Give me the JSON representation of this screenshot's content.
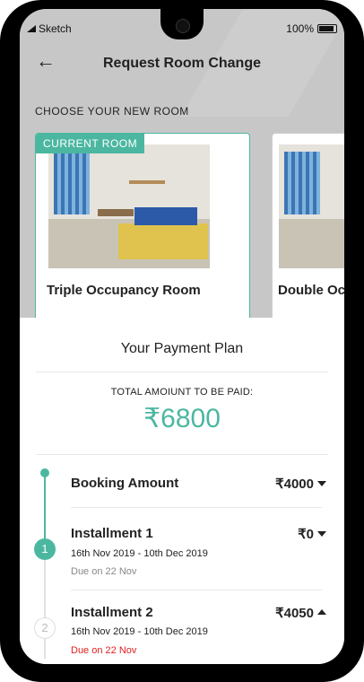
{
  "status_bar": {
    "carrier": "Sketch",
    "battery": "100%"
  },
  "header": {
    "title": "Request Room Change"
  },
  "section_label": "CHOOSE YOUR NEW ROOM",
  "rooms": [
    {
      "tag": "CURRENT ROOM",
      "name": "Triple Occupancy Room"
    },
    {
      "name": "Double Oc"
    }
  ],
  "payment_plan": {
    "title": "Your Payment Plan",
    "total_label": "TOTAL AMOIUNT TO BE PAID:",
    "total_amount": "₹6800",
    "items": [
      {
        "name": "Booking Amount",
        "amount": "₹4000"
      },
      {
        "step": "1",
        "name": "Installment 1",
        "amount": "₹0",
        "dates": "16th Nov 2019 - 10th Dec 2019",
        "due": "Due on 22 Nov"
      },
      {
        "step": "2",
        "name": "Installment 2",
        "amount": "₹4050",
        "dates": "16th Nov 2019 - 10th Dec 2019",
        "due": "Due on 22 Nov"
      }
    ]
  },
  "colors": {
    "accent": "#4cb7a1",
    "due_alert": "#e02020"
  }
}
